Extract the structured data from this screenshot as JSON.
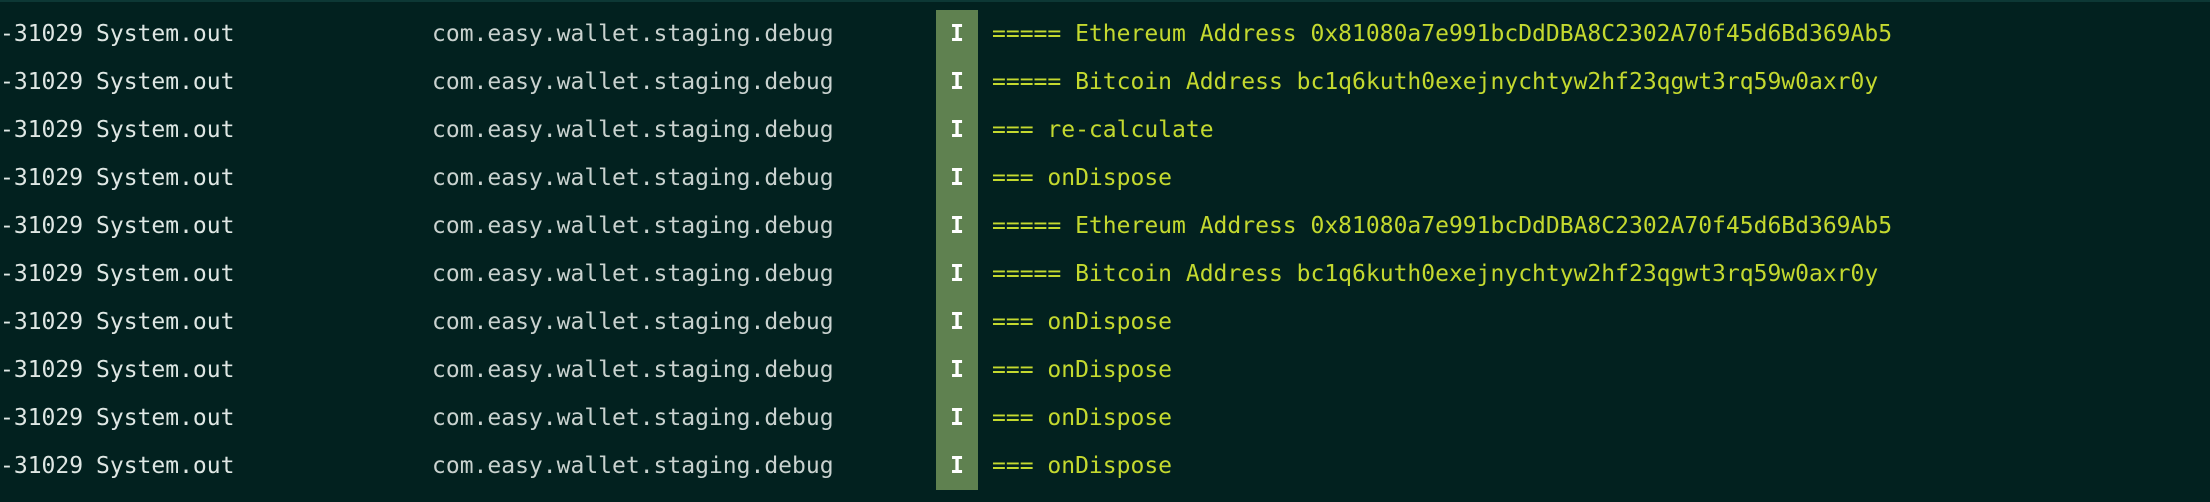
{
  "colors": {
    "background": "#02211f",
    "text": "#dfe7e4",
    "message": "#c4d92f",
    "level_badge": "#5f8150"
  },
  "log": {
    "rows": [
      {
        "pid": "-31029",
        "tag": "System.out",
        "package": "com.easy.wallet.staging.debug",
        "level": "I",
        "message": "===== Ethereum Address 0x81080a7e991bcDdDBA8C2302A70f45d6Bd369Ab5"
      },
      {
        "pid": "-31029",
        "tag": "System.out",
        "package": "com.easy.wallet.staging.debug",
        "level": "I",
        "message": "===== Bitcoin Address bc1q6kuth0exejnychtyw2hf23qgwt3rq59w0axr0y"
      },
      {
        "pid": "-31029",
        "tag": "System.out",
        "package": "com.easy.wallet.staging.debug",
        "level": "I",
        "message": "=== re-calculate"
      },
      {
        "pid": "-31029",
        "tag": "System.out",
        "package": "com.easy.wallet.staging.debug",
        "level": "I",
        "message": "=== onDispose"
      },
      {
        "pid": "-31029",
        "tag": "System.out",
        "package": "com.easy.wallet.staging.debug",
        "level": "I",
        "message": "===== Ethereum Address 0x81080a7e991bcDdDBA8C2302A70f45d6Bd369Ab5"
      },
      {
        "pid": "-31029",
        "tag": "System.out",
        "package": "com.easy.wallet.staging.debug",
        "level": "I",
        "message": "===== Bitcoin Address bc1q6kuth0exejnychtyw2hf23qgwt3rq59w0axr0y"
      },
      {
        "pid": "-31029",
        "tag": "System.out",
        "package": "com.easy.wallet.staging.debug",
        "level": "I",
        "message": "=== onDispose"
      },
      {
        "pid": "-31029",
        "tag": "System.out",
        "package": "com.easy.wallet.staging.debug",
        "level": "I",
        "message": "=== onDispose"
      },
      {
        "pid": "-31029",
        "tag": "System.out",
        "package": "com.easy.wallet.staging.debug",
        "level": "I",
        "message": "=== onDispose"
      },
      {
        "pid": "-31029",
        "tag": "System.out",
        "package": "com.easy.wallet.staging.debug",
        "level": "I",
        "message": "=== onDispose"
      }
    ]
  }
}
